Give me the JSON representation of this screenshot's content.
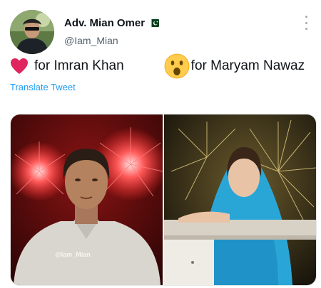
{
  "tweet": {
    "display_name": "Adv. Mian Omer",
    "handle": "@Iam_Mian",
    "text_part1": "for Imran Khan",
    "text_part2": "for Maryam Nawaz",
    "translate_label": "Translate Tweet",
    "watermark": "@Iam_Mian"
  },
  "icons": {
    "heart": "red-heart-icon",
    "wow": "face-with-open-mouth-icon",
    "flag": "pakistan-flag-icon",
    "more": "more-options-icon"
  },
  "colors": {
    "heart": "#e0245e",
    "link": "#1d9bf0",
    "handle": "#536471"
  }
}
